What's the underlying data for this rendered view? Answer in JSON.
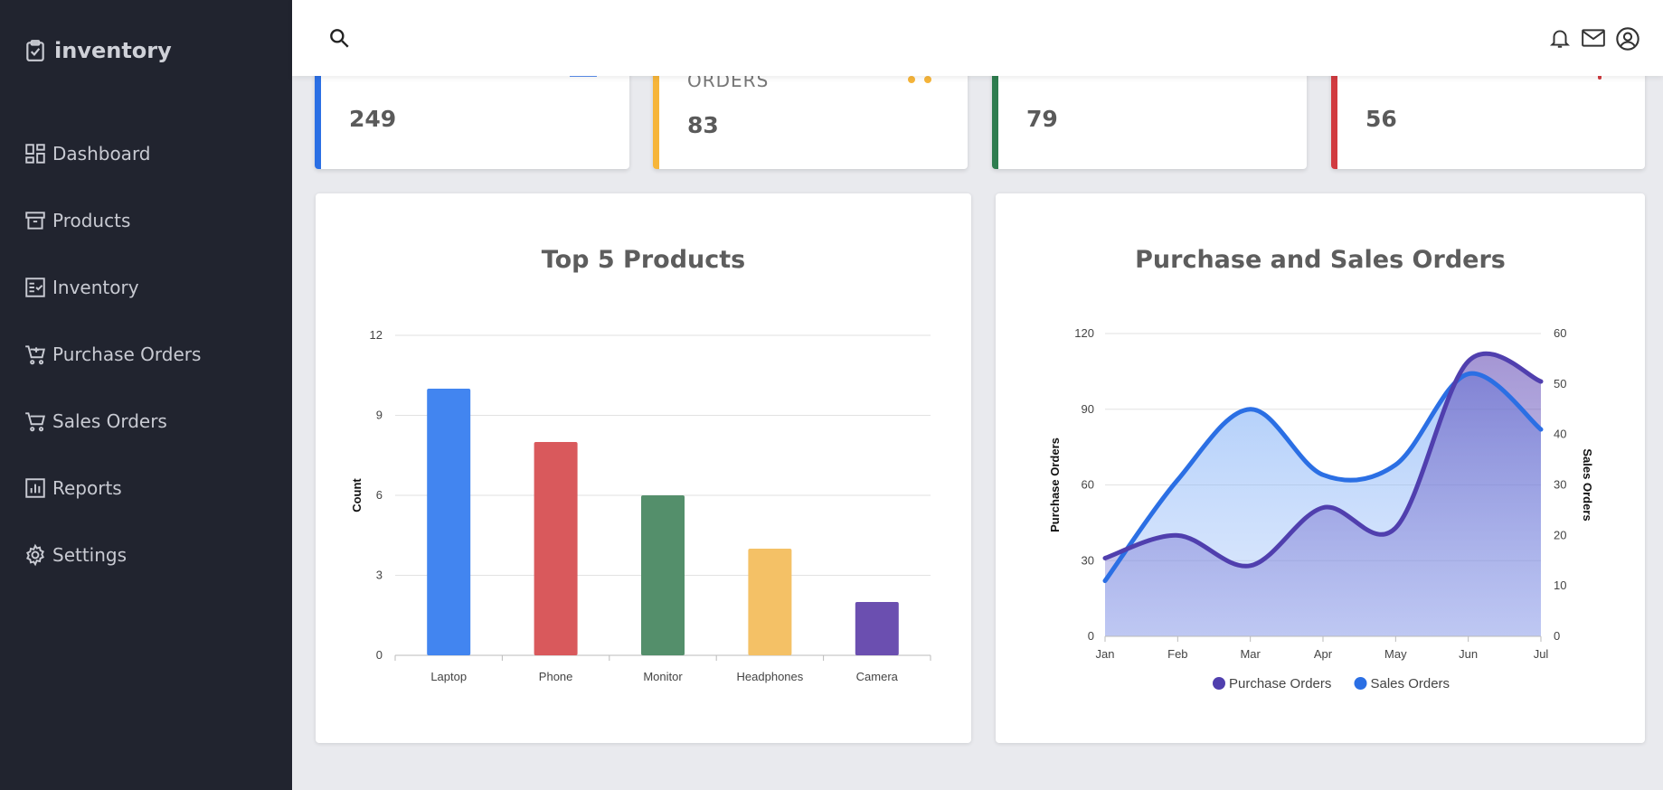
{
  "app": {
    "brand": "inventory"
  },
  "sidebar": {
    "items": [
      {
        "label": "Dashboard",
        "icon": "dashboard-icon"
      },
      {
        "label": "Products",
        "icon": "archive-icon"
      },
      {
        "label": "Inventory",
        "icon": "checklist-icon"
      },
      {
        "label": "Purchase Orders",
        "icon": "cart-add-icon"
      },
      {
        "label": "Sales Orders",
        "icon": "cart-icon"
      },
      {
        "label": "Reports",
        "icon": "bar-chart-icon"
      },
      {
        "label": "Settings",
        "icon": "gear-icon"
      }
    ]
  },
  "topbar": {
    "icons": [
      "search-icon",
      "bell-icon",
      "mail-icon",
      "account-icon"
    ]
  },
  "stats": [
    {
      "value": "249",
      "caption": "",
      "color": "#2b6fe4"
    },
    {
      "value": "83",
      "caption": "ORDERS",
      "color": "#f6b53a"
    },
    {
      "value": "79",
      "caption": "",
      "color": "#2e7d4f"
    },
    {
      "value": "56",
      "caption": "",
      "color": "#d13b40"
    }
  ],
  "chart_data": [
    {
      "type": "bar",
      "title": "Top 5 Products",
      "categories": [
        "Laptop",
        "Phone",
        "Monitor",
        "Headphones",
        "Camera"
      ],
      "values": [
        10,
        8,
        6,
        4,
        2
      ],
      "colors": [
        "#4285f0",
        "#d9595c",
        "#548f6b",
        "#f4c166",
        "#6b4fb0"
      ],
      "xlabel": "",
      "ylabel": "Count",
      "ylim": [
        0,
        12
      ],
      "yticks": [
        "0",
        "3",
        "6",
        "9",
        "12"
      ],
      "grid": true
    },
    {
      "type": "area",
      "title": "Purchase and Sales Orders",
      "x": [
        "Jan",
        "Feb",
        "Mar",
        "Apr",
        "May",
        "Jun",
        "Jul"
      ],
      "series": [
        {
          "name": "Purchase Orders",
          "axis": "left",
          "values": [
            31,
            40,
            28,
            51,
            43,
            109,
            101
          ],
          "color": "#503fae"
        },
        {
          "name": "Sales Orders",
          "axis": "right",
          "values": [
            11,
            31,
            45,
            32,
            34,
            52,
            41
          ],
          "color": "#2b6fe4"
        }
      ],
      "ylabel_left": "Purchase Orders",
      "ylabel_right": "Sales Orders",
      "ylim_left": [
        0,
        120
      ],
      "ylim_right": [
        0,
        60
      ],
      "yticks_left": [
        "0",
        "30",
        "60",
        "90",
        "120"
      ],
      "yticks_right": [
        "0",
        "10",
        "20",
        "30",
        "40",
        "50",
        "60"
      ],
      "legend": "bottom",
      "grid": true
    }
  ]
}
